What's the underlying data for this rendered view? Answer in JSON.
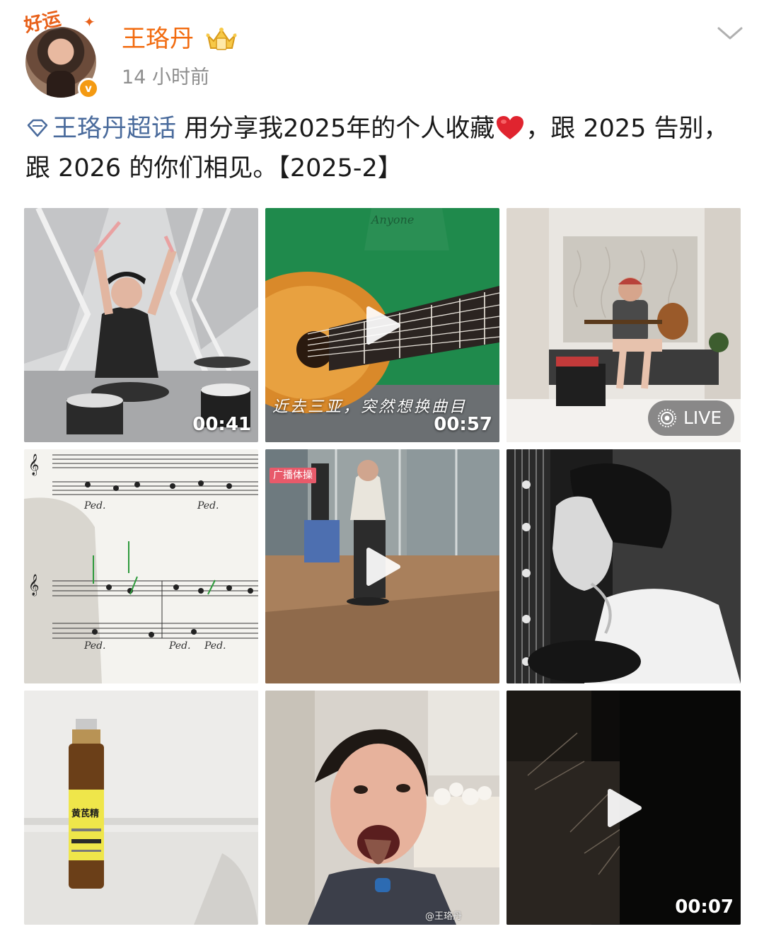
{
  "header": {
    "user_name": "王珞丹",
    "timestamp": "14 小时前",
    "avatar_badge_text": "好运",
    "verified_mark": "v",
    "icons": [
      "crown-member-icon",
      "chevron-down-icon",
      "verified-badge-icon"
    ]
  },
  "post": {
    "topic": "王珞丹超话",
    "text_before_heart": " 用分享我2025年的个人收藏",
    "text_after_heart": "，跟 2025 告别，跟 2026 的你们相见。【2025-2】"
  },
  "media": [
    {
      "kind": "video",
      "duration": "00:41",
      "play": false
    },
    {
      "kind": "video",
      "duration": "00:57",
      "play": true,
      "caption": "近去三亚，突然想换曲目"
    },
    {
      "kind": "live",
      "badge": "LIVE"
    },
    {
      "kind": "image"
    },
    {
      "kind": "video",
      "play": true,
      "tag": "广播体操"
    },
    {
      "kind": "image"
    },
    {
      "kind": "image",
      "label": "黄芪精"
    },
    {
      "kind": "image",
      "watermark": "@王珞丹"
    },
    {
      "kind": "video",
      "duration": "00:07",
      "play": true
    }
  ],
  "colors": {
    "name": "#f26b0f",
    "topic": "#4a6b9c",
    "heart": "#e0242f",
    "meta": "#8e8e8e"
  }
}
